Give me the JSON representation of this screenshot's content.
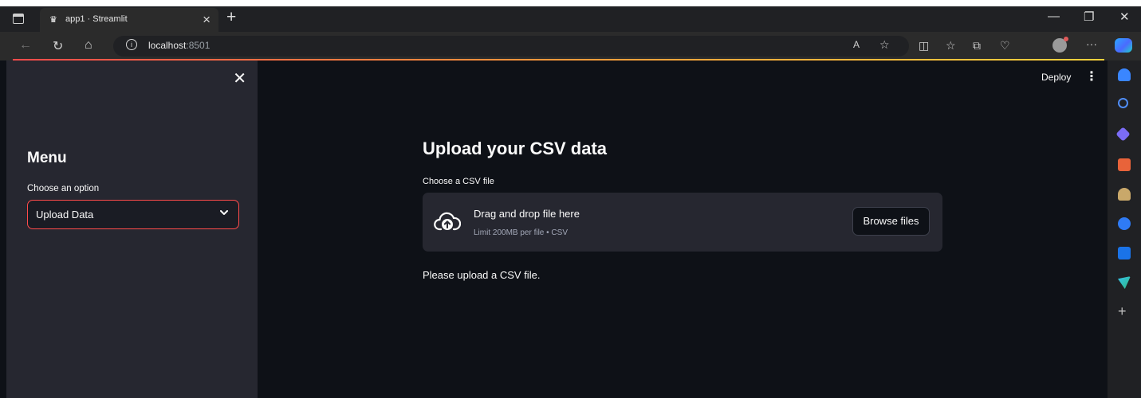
{
  "browser": {
    "tab_title": "app1 · Streamlit",
    "tab_favicon": "streamlit-crown",
    "tab_close": "×",
    "new_tab": "+",
    "window_min": "—",
    "window_restore": "❐",
    "window_close": "✕",
    "url_host": "localhost",
    "url_port": ":8501",
    "info_glyph": "i",
    "more_glyph": "···"
  },
  "sidebar": {
    "close_glyph": "✕",
    "menu_title": "Menu",
    "choose_label": "Choose an option",
    "selected_option": "Upload Data",
    "chevron": "⌄"
  },
  "header": {
    "deploy_label": "Deploy",
    "kebab": "⋮"
  },
  "main": {
    "title": "Upload your CSV data",
    "file_label": "Choose a CSV file",
    "dropzone_title": "Drag and drop file here",
    "dropzone_limit": "Limit 200MB per file • CSV",
    "browse_label": "Browse files",
    "info_text": "Please upload a CSV file."
  },
  "colors": {
    "accent": "#ff4b4b",
    "background": "#0e1117",
    "sidebar": "#262730"
  }
}
